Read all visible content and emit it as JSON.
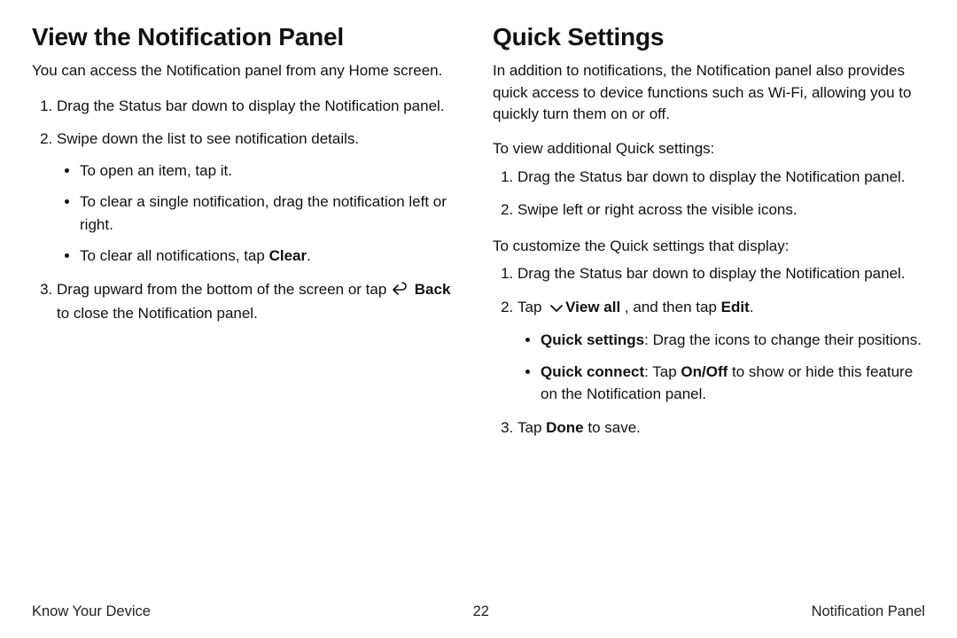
{
  "left": {
    "heading": "View the Notification Panel",
    "intro": "You can access the Notification panel from any Home screen.",
    "step1": "Drag the Status bar down to display the Notification panel.",
    "step2": "Swipe down the list to see notification details.",
    "bullets": {
      "b1": "To open an item, tap it.",
      "b2": "To clear a single notification, drag the notification left or right.",
      "b3_pre": "To clear all notifications, tap ",
      "b3_bold": "Clear",
      "b3_post": "."
    },
    "step3_pre": "Drag upward from the bottom of the screen or tap ",
    "step3_bold": "Back",
    "step3_post": " to close the Notification panel."
  },
  "right": {
    "heading": "Quick Settings",
    "intro": "In addition to notifications, the Notification panel also provides quick access to device functions such as Wi-Fi, allowing you to quickly turn them on or off.",
    "view_intro": "To view additional Quick settings:",
    "view_step1": "Drag the Status bar down to display the Notification panel.",
    "view_step2": "Swipe left or right across the visible icons.",
    "cust_intro": "To customize the Quick settings that display:",
    "cust_step1": "Drag the Status bar down to display the Notification panel.",
    "cust_step2_pre": "Tap ",
    "cust_step2_bold1": "View all",
    "cust_step2_mid": " , and then tap ",
    "cust_step2_bold2": "Edit",
    "cust_step2_post": ".",
    "cust_b1_bold": "Quick settings",
    "cust_b1_rest": ": Drag the icons to change their positions.",
    "cust_b2_bold1": "Quick connect",
    "cust_b2_mid1": ": Tap ",
    "cust_b2_bold2": "On/Off",
    "cust_b2_rest": " to show or hide this feature on the Notification panel.",
    "cust_step3_pre": "Tap ",
    "cust_step3_bold": "Done",
    "cust_step3_post": " to save."
  },
  "footer": {
    "left": "Know Your Device",
    "center": "22",
    "right": "Notification Panel"
  }
}
